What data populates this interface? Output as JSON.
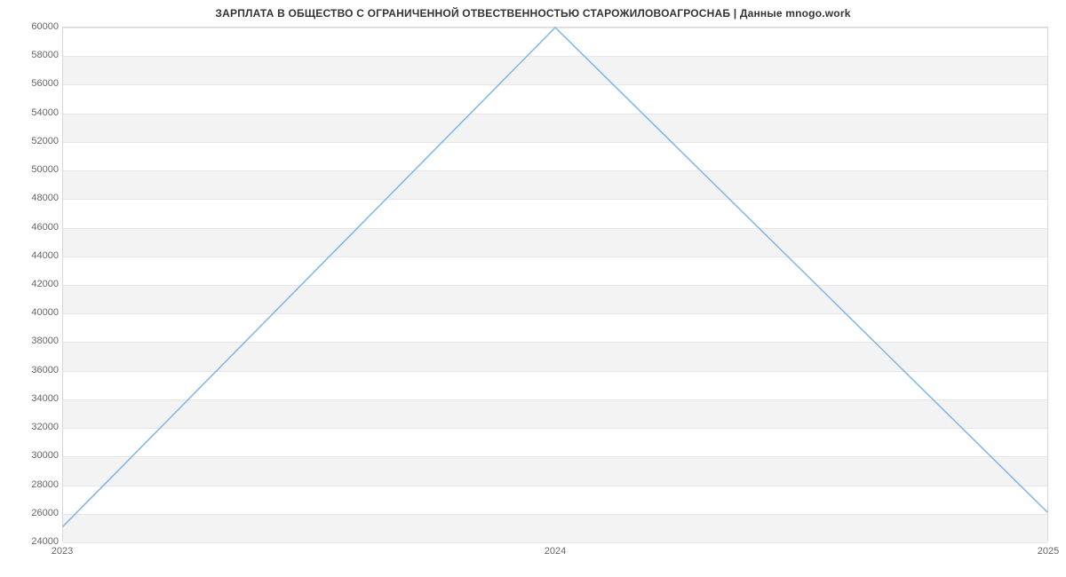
{
  "chart_data": {
    "type": "line",
    "title": "ЗАРПЛАТА В ОБЩЕСТВО С ОГРАНИЧЕННОЙ ОТВЕСТВЕННОСТЬЮ  СТАРОЖИЛОВОАГРОСНАБ | Данные mnogo.work",
    "xlabel": "",
    "ylabel": "",
    "x": [
      2023,
      2024,
      2025
    ],
    "series": [
      {
        "name": "salary",
        "values": [
          25000,
          60000,
          26000
        ]
      }
    ],
    "ylim": [
      24000,
      60000
    ],
    "yticks": [
      24000,
      26000,
      28000,
      30000,
      32000,
      34000,
      36000,
      38000,
      40000,
      42000,
      44000,
      46000,
      48000,
      50000,
      52000,
      54000,
      56000,
      58000,
      60000
    ],
    "xticks": [
      2023,
      2024,
      2025
    ],
    "line_color": "#7cb5ec",
    "band_color": "#f3f3f3"
  }
}
